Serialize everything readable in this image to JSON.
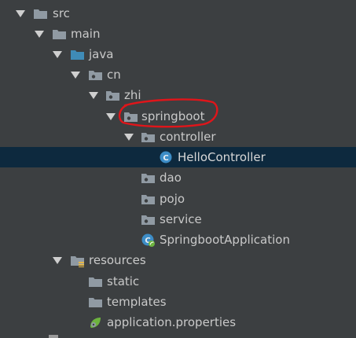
{
  "tree": {
    "nodes": [
      {
        "label": "src",
        "icon": "folder-icon"
      },
      {
        "label": "main",
        "icon": "folder-icon"
      },
      {
        "label": "java",
        "icon": "source-root-folder-icon"
      },
      {
        "label": "cn",
        "icon": "package-icon"
      },
      {
        "label": "zhi",
        "icon": "package-icon"
      },
      {
        "label": "springboot",
        "icon": "package-icon"
      },
      {
        "label": "controller",
        "icon": "package-icon"
      },
      {
        "label": "HelloController",
        "icon": "class-icon"
      },
      {
        "label": "dao",
        "icon": "package-icon"
      },
      {
        "label": "pojo",
        "icon": "package-icon"
      },
      {
        "label": "service",
        "icon": "package-icon"
      },
      {
        "label": "SpringbootApplication",
        "icon": "spring-boot-class-icon"
      },
      {
        "label": "resources",
        "icon": "resources-folder-icon"
      },
      {
        "label": "static",
        "icon": "folder-icon"
      },
      {
        "label": "templates",
        "icon": "folder-icon"
      },
      {
        "label": "application.properties",
        "icon": "properties-file-icon"
      }
    ],
    "selected": "HelloController"
  },
  "colors": {
    "background": "#3c3f41",
    "selection": "#0d293e",
    "folder": "#909aa3",
    "source_root": "#3f8bb7",
    "annotation": "#e0151a"
  }
}
